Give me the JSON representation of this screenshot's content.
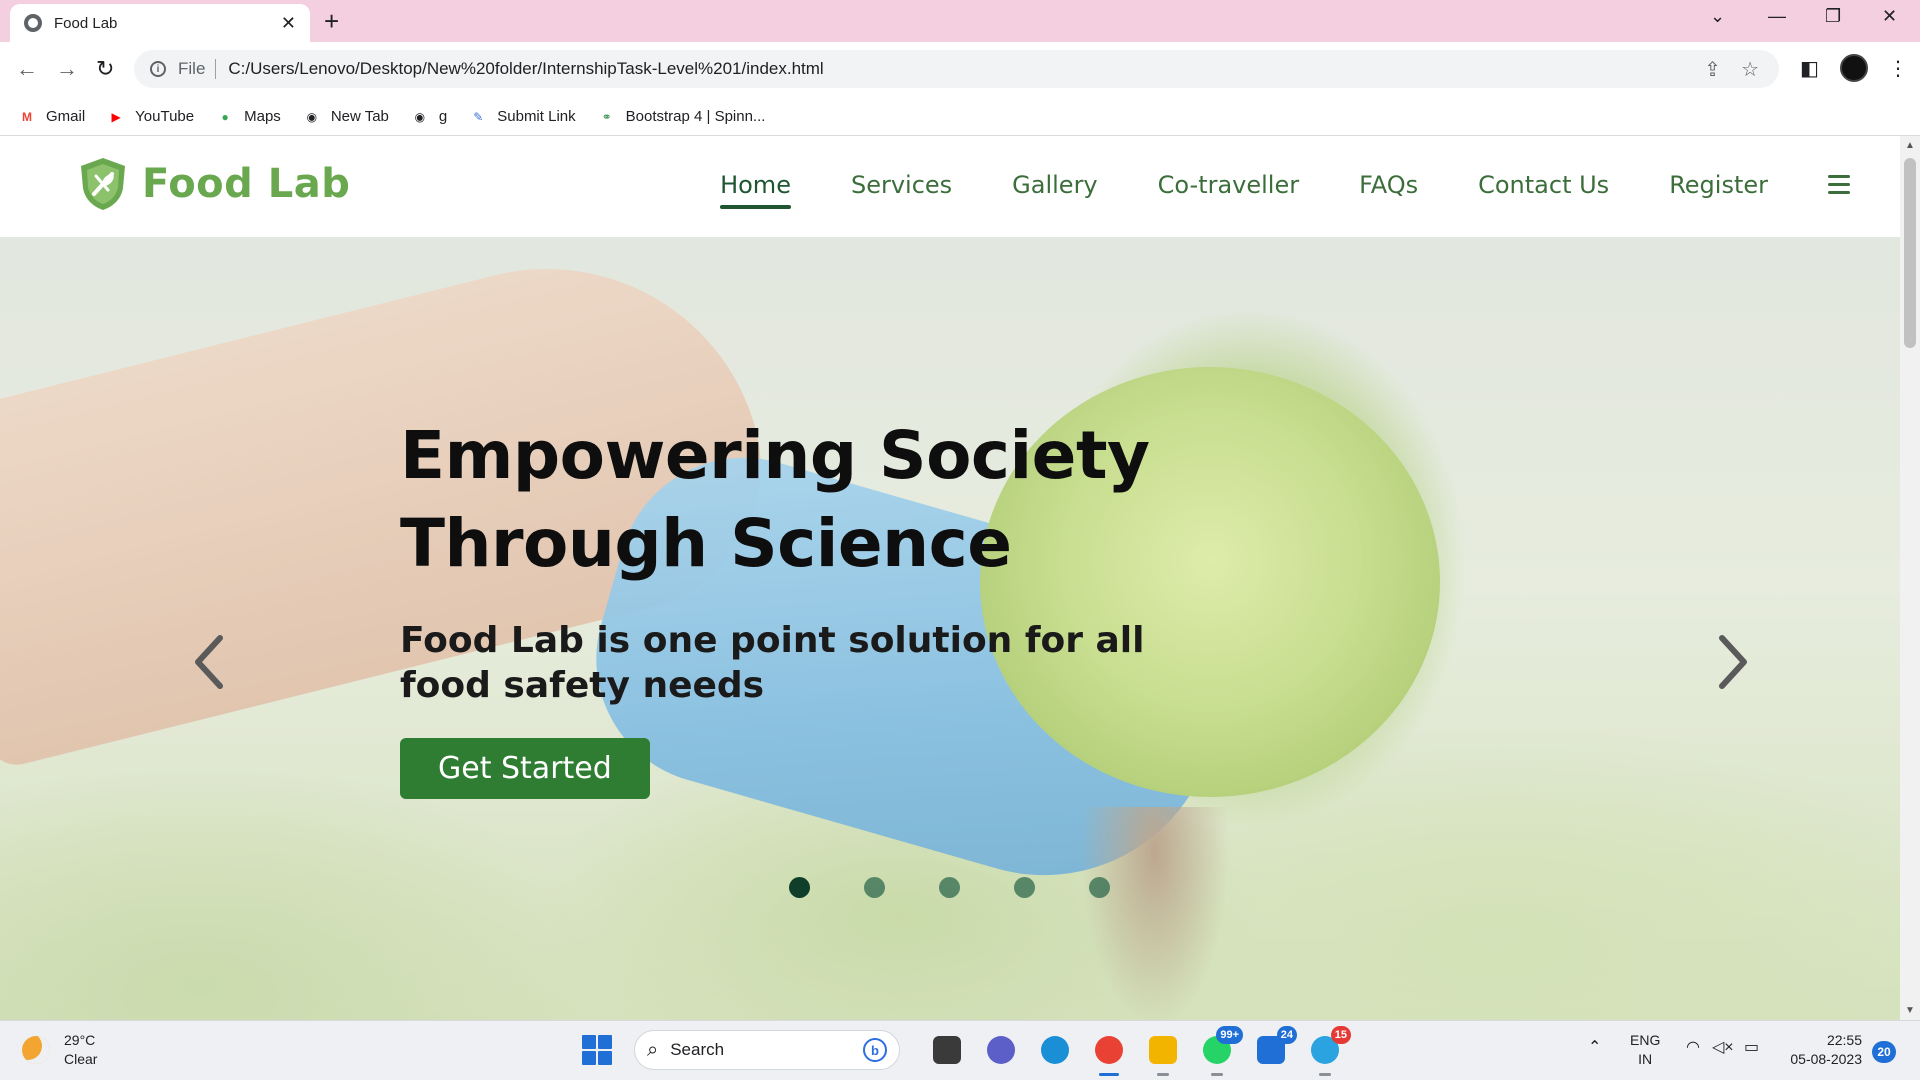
{
  "browser": {
    "tab": {
      "title": "Food Lab"
    },
    "url_scheme": "File",
    "url": "C:/Users/Lenovo/Desktop/New%20folder/InternshipTask-Level%201/index.html",
    "bookmarks": [
      {
        "label": "Gmail",
        "icon": "gmail-icon",
        "color": "#ea4335",
        "glyph": "M"
      },
      {
        "label": "YouTube",
        "icon": "youtube-icon",
        "color": "#ff0000",
        "glyph": "▶"
      },
      {
        "label": "Maps",
        "icon": "maps-icon",
        "color": "#34a853",
        "glyph": "●"
      },
      {
        "label": "New Tab",
        "icon": "globe-icon",
        "color": "#202124",
        "glyph": "◉"
      },
      {
        "label": "g",
        "icon": "globe-icon",
        "color": "#202124",
        "glyph": "◉"
      },
      {
        "label": "Submit Link",
        "icon": "submit-link-icon",
        "color": "#3b6fd6",
        "glyph": "✎"
      },
      {
        "label": "Bootstrap 4 | Spinn...",
        "icon": "geeks-icon",
        "color": "#2f8d46",
        "glyph": "⚭"
      }
    ]
  },
  "site": {
    "brand": "Food Lab",
    "colors": {
      "brand_green": "#6aa84f",
      "nav_green": "#3b6e3b",
      "cta_green": "#2e7d32",
      "dot_active": "#0f3f2a"
    },
    "nav": {
      "items": [
        "Home",
        "Services",
        "Gallery",
        "Co-traveller",
        "FAQs",
        "Contact Us",
        "Register"
      ],
      "active": "Home"
    },
    "hero": {
      "title_line1": "Empowering Society",
      "title_line2": "Through Science",
      "subtitle": "Food Lab is one point solution for all food safety needs",
      "cta": "Get Started",
      "slide_count": 5,
      "active_slide": 1
    }
  },
  "taskbar": {
    "weather": {
      "temp": "29°C",
      "condition": "Clear"
    },
    "search_label": "Search",
    "apps": [
      {
        "name": "task-view",
        "color": "#3a3a3a"
      },
      {
        "name": "teams",
        "color": "#5b5fc7"
      },
      {
        "name": "edge",
        "color": "#1a8fd6"
      },
      {
        "name": "chrome",
        "color": "#e94235",
        "running": true
      },
      {
        "name": "file-explorer",
        "color": "#f3b400"
      },
      {
        "name": "whatsapp",
        "color": "#25d366",
        "badge": "99+"
      },
      {
        "name": "mail",
        "color": "#1f6fd6",
        "badge": "24"
      },
      {
        "name": "telegram",
        "color": "#2aa3e0",
        "badge": "15"
      }
    ],
    "language": {
      "line1": "ENG",
      "line2": "IN"
    },
    "time": "22:55",
    "date": "05-08-2023",
    "notifications": "20"
  }
}
